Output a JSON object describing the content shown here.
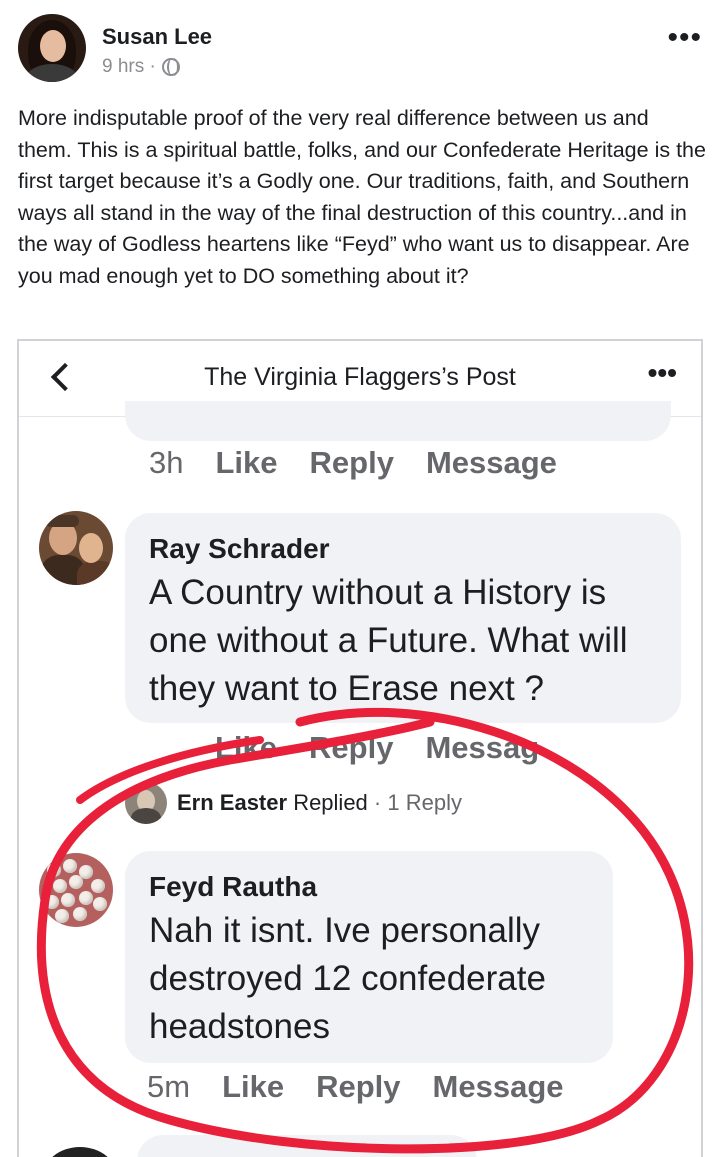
{
  "post": {
    "author": "Susan Lee",
    "time": "9 hrs ·",
    "more_icon": "more-horizontal-icon",
    "privacy_icon": "globe-icon",
    "text": "More indisputable proof of the very real difference between us and them. This is a spiritual battle, folks, and our Confederate Heritage is the first target because it’s a Godly one. Our traditions, faith, and Southern ways all stand in the way of the final destruction of this country...and in the way of Godless heartens like “Feyd” who want us to disappear. Are you mad enough yet to DO something about it?"
  },
  "screenshot": {
    "title": "The Virginia Flaggers’s Post",
    "top_actions": {
      "time": "3h",
      "like": "Like",
      "reply": "Reply",
      "message": "Message"
    },
    "comment1": {
      "name": "Ray Schrader",
      "text": "A Country without a History is one without a Future. What will they want to Erase next ?",
      "actions": {
        "like": "Like",
        "reply": "Reply",
        "message": "Messag"
      }
    },
    "replied": {
      "name": "Ern Easter",
      "verb": "Replied",
      "count": "· 1 Reply"
    },
    "comment2": {
      "name": "Feyd Rautha",
      "text": "Nah it isnt. Ive personally destroyed 12 confederate headstones",
      "actions": {
        "time": "5m",
        "like": "Like",
        "reply": "Reply",
        "message": "Message"
      }
    }
  },
  "colors": {
    "annotation_red": "#e8203a",
    "bubble": "#f0f2f5",
    "muted": "#65676b"
  }
}
